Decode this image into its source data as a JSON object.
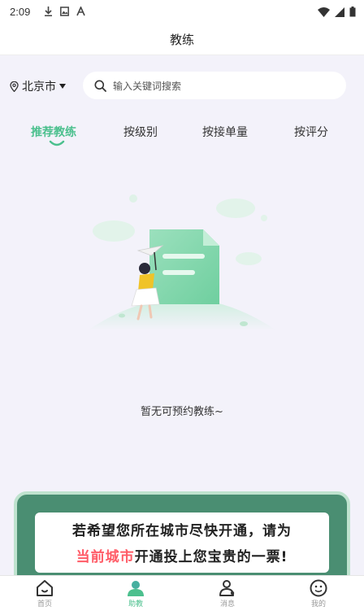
{
  "status_bar": {
    "time": "2:09",
    "left_icons": [
      "download-icon",
      "photo-icon",
      "font-icon"
    ],
    "right_icons": [
      "wifi-icon",
      "signal-icon",
      "battery-icon"
    ]
  },
  "header": {
    "title": "教练"
  },
  "filter": {
    "city": "北京市",
    "search_placeholder": "输入关键词搜索"
  },
  "tabs": [
    {
      "label": "推荐教练",
      "active": true
    },
    {
      "label": "按级别",
      "active": false
    },
    {
      "label": "按接单量",
      "active": false
    },
    {
      "label": "按评分",
      "active": false
    }
  ],
  "empty_state": {
    "message": "暂无可预约教练~"
  },
  "promo": {
    "line1": "若希望您所在城市尽快开通，请为",
    "line2_highlight": "当前城市",
    "line2_rest": "开通投上您宝贵的一票!"
  },
  "bottom_nav": [
    {
      "label": "首页",
      "icon": "home-icon",
      "active": false
    },
    {
      "label": "助教",
      "icon": "coach-icon",
      "active": true
    },
    {
      "label": "消息",
      "icon": "message-icon",
      "active": false
    },
    {
      "label": "我的",
      "icon": "profile-icon",
      "active": false
    }
  ],
  "colors": {
    "accent": "#4cc08e",
    "highlight": "#ff5b66",
    "background": "#f3f2fa",
    "promo_bg": "#4a8e72"
  }
}
